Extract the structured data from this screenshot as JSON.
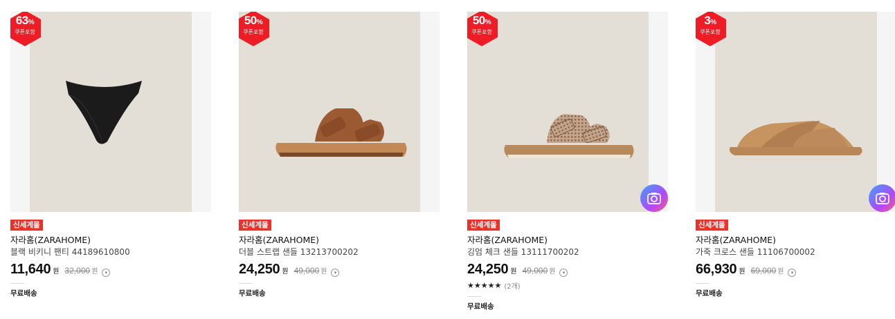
{
  "colors": {
    "badge": "#ee1c25",
    "tag": "#e8322b",
    "camera_gradient": [
      "#3aa5ff",
      "#b048ff",
      "#ff5a7a"
    ]
  },
  "products": [
    {
      "discount": "63",
      "discount_unit": "%",
      "coupon_label": "쿠폰포함",
      "tag": "신세계몰",
      "brand": "자라홈(ZARAHOME)",
      "name": "블랙 비키니 팬티 44189610800",
      "price": "11,640",
      "price_unit": "원",
      "original_price": "32,000",
      "original_unit": "원",
      "shipping": "무료배송",
      "image_icon": "bikini-image"
    },
    {
      "discount": "50",
      "discount_unit": "%",
      "coupon_label": "쿠폰포함",
      "tag": "신세계몰",
      "brand": "자라홈(ZARAHOME)",
      "name": "더블 스트랩 샌들 13213700202",
      "price": "24,250",
      "price_unit": "원",
      "original_price": "49,000",
      "original_unit": "원",
      "shipping": "무료배송",
      "image_icon": "sandal-image"
    },
    {
      "discount": "50",
      "discount_unit": "%",
      "coupon_label": "쿠폰포함",
      "tag": "신세계몰",
      "brand": "자라홈(ZARAHOME)",
      "name": "깅엄 체크 샌들 13111700202",
      "price": "24,250",
      "price_unit": "원",
      "original_price": "49,000",
      "original_unit": "원",
      "rating_stars": "★★★★★",
      "rating_count": "(2개)",
      "shipping": "무료배송",
      "image_icon": "gingham-sandal-image",
      "camera_icon": "camera-search-icon"
    },
    {
      "discount": "3",
      "discount_unit": "%",
      "coupon_label": "쿠폰포함",
      "tag": "신세계몰",
      "brand": "자라홈(ZARAHOME)",
      "name": "가죽 크로스 샌들 11106700002",
      "price": "66,930",
      "price_unit": "원",
      "original_price": "69,000",
      "original_unit": "원",
      "shipping": "무료배송",
      "image_icon": "cross-sandal-image",
      "camera_icon": "camera-search-icon"
    }
  ]
}
